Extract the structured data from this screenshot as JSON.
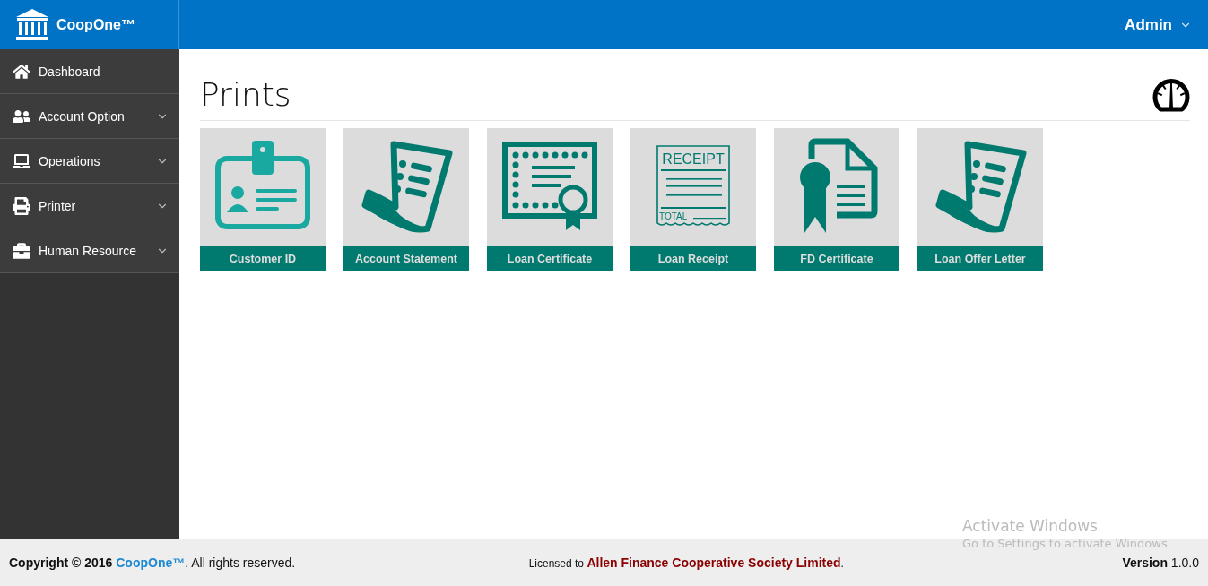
{
  "header": {
    "brand": "CoopOne™",
    "user": "Admin"
  },
  "sidebar": {
    "items": [
      {
        "label": "Dashboard",
        "expandable": false
      },
      {
        "label": "Account Option",
        "expandable": true
      },
      {
        "label": "Operations",
        "expandable": true
      },
      {
        "label": "Printer",
        "expandable": true
      },
      {
        "label": "Human Resource",
        "expandable": true
      }
    ]
  },
  "page": {
    "title": "Prints"
  },
  "cards": [
    {
      "label": "Customer ID",
      "kind": "id-card"
    },
    {
      "label": "Account Statement",
      "kind": "scroll"
    },
    {
      "label": "Loan Certificate",
      "kind": "certificate"
    },
    {
      "label": "Loan Receipt",
      "kind": "receipt",
      "icon_texts": [
        "RECEIPT",
        "TOTAL"
      ]
    },
    {
      "label": "FD Certificate",
      "kind": "award"
    },
    {
      "label": "Loan Offer Letter",
      "kind": "scroll"
    }
  ],
  "footer": {
    "copyright_prefix": "Copyright © 2016",
    "copyright_brand": "CoopOne™",
    "copyright_suffix": ". All rights reserved.",
    "licensed_prefix": "Licensed to",
    "licensee": "Allen Finance Cooperative Society Limited",
    "licensed_suffix": ".",
    "version_label": "Version",
    "version": "1.0.0"
  },
  "windows_activation": {
    "title": "Activate Windows",
    "message": "Go to Settings to activate Windows."
  }
}
